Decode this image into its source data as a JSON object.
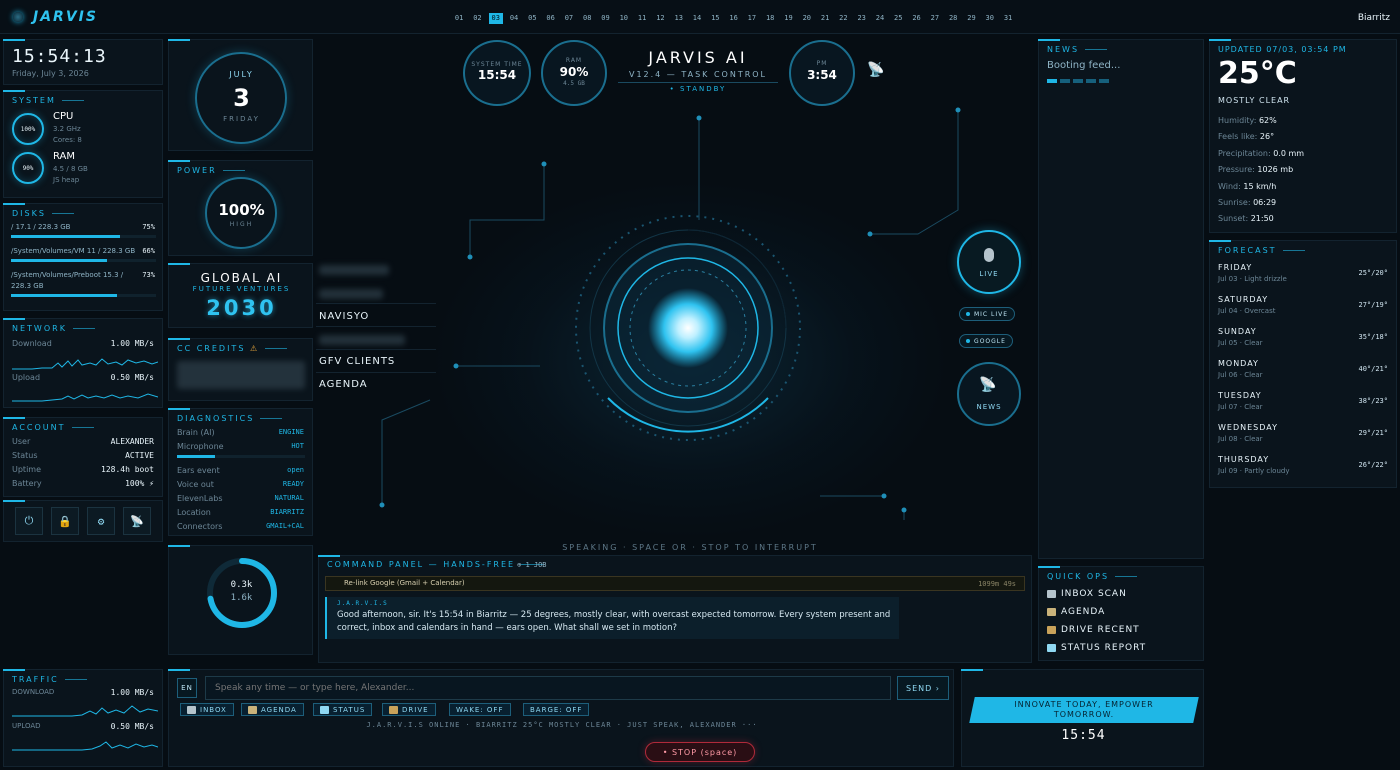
{
  "header": {
    "logo": "JARVIS",
    "days": [
      "01",
      "02",
      "03",
      "04",
      "05",
      "06",
      "07",
      "08",
      "09",
      "10",
      "11",
      "12",
      "13",
      "14",
      "15",
      "16",
      "17",
      "18",
      "19",
      "20",
      "21",
      "22",
      "23",
      "24",
      "25",
      "26",
      "27",
      "28",
      "29",
      "30",
      "31"
    ],
    "active_day": "03",
    "city": "Biarritz"
  },
  "clock": {
    "time": "15:54:13",
    "date": "Friday, July 3, 2026"
  },
  "system": {
    "title": "SYSTEM",
    "cpu": {
      "label": "CPU",
      "pct": "100%",
      "ghz": "3.2 GHz",
      "cores": "Cores: 8"
    },
    "ram": {
      "label": "RAM",
      "pct": "90%",
      "mem": "4.5 / 8 GB",
      "note": "JS heap"
    }
  },
  "disks": {
    "title": "DISKS",
    "items": [
      {
        "name": "/ 17.1 / 228.3 GB",
        "extra": "",
        "pct": "75%",
        "value": 75
      },
      {
        "name": "/System/Volumes/VM 11 / 228.3 GB",
        "extra": "",
        "pct": "66%",
        "value": 66
      },
      {
        "name": "/System/Volumes/Preboot 15.3 /",
        "extra": "228.3 GB",
        "pct": "73%",
        "value": 73
      }
    ]
  },
  "network": {
    "title": "NETWORK",
    "download_label": "Download",
    "download_value": "1.00 MB/s",
    "upload_label": "Upload",
    "upload_value": "0.50 MB/s"
  },
  "account": {
    "title": "ACCOUNT",
    "rows": [
      {
        "k": "User",
        "v": "ALEXANDER"
      },
      {
        "k": "Status",
        "v": "ACTIVE"
      },
      {
        "k": "Uptime",
        "v": "128.4h boot"
      },
      {
        "k": "Battery",
        "v": "100% ⚡"
      }
    ]
  },
  "traffic": {
    "title": "TRAFFIC",
    "download_label": "DOWNLOAD",
    "download_value": "1.00 MB/s",
    "upload_label": "UPLOAD",
    "upload_value": "0.50 MB/s"
  },
  "calendar": {
    "month": "JULY",
    "day": "3",
    "weekday": "FRIDAY"
  },
  "power": {
    "title": "POWER",
    "value": "100%",
    "level": "HIGH"
  },
  "brand": {
    "title": "GLOBAL AI",
    "subtitle": "FUTURE VENTURES",
    "year": "2030"
  },
  "cc_credits": {
    "title": "CC CREDITS",
    "warning": "⚠"
  },
  "diagnostics": {
    "title": "DIAGNOSTICS",
    "rows": [
      {
        "k": "Brain (AI)",
        "v": "ENGINE"
      },
      {
        "k": "Microphone",
        "v": "HOT"
      },
      {
        "k": "Ears event",
        "v": "open"
      },
      {
        "k": "Voice out",
        "v": "READY"
      },
      {
        "k": "ElevenLabs",
        "v": "NATURAL"
      },
      {
        "k": "Location",
        "v": "BIARRITZ"
      },
      {
        "k": "Connectors",
        "v": "GMAIL+CAL"
      }
    ]
  },
  "gauge": {
    "top": "0.3k",
    "bottom": "1.6k",
    "fraction": 0.72
  },
  "menu": {
    "items": [
      "NAVISYO",
      "GFV CLIENTS",
      "AGENDA"
    ]
  },
  "center": {
    "sys_time_label": "SYSTEM TIME",
    "sys_time": "15:54",
    "ram_label": "RAM",
    "ram_pct": "90%",
    "ram_gb": "4.5 GB",
    "title": "JARVIS AI",
    "version": "V12.4 — TASK CONTROL",
    "status": "STANDBY",
    "pm_label": "PM",
    "pm_time": "3:54",
    "live_label": "LIVE",
    "mic_live": "MIC LIVE",
    "google": "GOOGLE",
    "news_label": "NEWS",
    "speaking": "SPEAKING · SPACE OR · STOP TO INTERRUPT"
  },
  "command": {
    "title": "COMMAND PANEL — HANDS-FREE",
    "job": "1 JOB",
    "task": "Re-link Google (Gmail + Calendar)",
    "task_time": "1099m 49s",
    "speaker": "J.A.R.V.I.S",
    "message": "Good afternoon, sir. It's 15:54 in Biarritz — 25 degrees, mostly clear, with overcast expected tomorrow. Every system present and correct, inbox and calendars in hand — ears open. What shall we set in motion?"
  },
  "input": {
    "lang": "EN",
    "placeholder": "Speak any time — or type here, Alexander...",
    "send": "SEND ›",
    "quick": [
      "INBOX",
      "AGENDA",
      "STATUS",
      "DRIVE",
      "WAKE: OFF",
      "BARGE: OFF"
    ],
    "ticker": "J.A.R.V.I.S ONLINE · BIARRITZ 25°C MOSTLY CLEAR · JUST SPEAK, ALEXANDER ···",
    "stop": "• STOP (space)"
  },
  "news": {
    "title": "NEWS",
    "status": "Booting feed..."
  },
  "quick_ops": {
    "title": "QUICK OPS",
    "items": [
      "INBOX SCAN",
      "AGENDA",
      "DRIVE RECENT",
      "STATUS REPORT"
    ]
  },
  "slogan": {
    "text": "INNOVATE TODAY, EMPOWER TOMORROW.",
    "time": "15:54"
  },
  "weather": {
    "updated_label": "UPDATED",
    "updated": "07/03, 03:54 PM",
    "temp": "25°C",
    "cond": "MOSTLY CLEAR",
    "rows": [
      {
        "k": "Humidity:",
        "v": "62%"
      },
      {
        "k": "Feels like:",
        "v": "26°"
      },
      {
        "k": "Precipitation:",
        "v": "0.0 mm"
      },
      {
        "k": "Pressure:",
        "v": "1026 mb"
      },
      {
        "k": "Wind:",
        "v": "15 km/h"
      },
      {
        "k": "Sunrise:",
        "v": "06:29"
      },
      {
        "k": "Sunset:",
        "v": "21:50"
      }
    ]
  },
  "forecast": {
    "title": "FORECAST",
    "days": [
      {
        "day": "FRIDAY",
        "sub": "Jul 03 · Light drizzle",
        "temp": "25°/20°"
      },
      {
        "day": "SATURDAY",
        "sub": "Jul 04 · Overcast",
        "temp": "27°/19°"
      },
      {
        "day": "SUNDAY",
        "sub": "Jul 05 · Clear",
        "temp": "35°/18°"
      },
      {
        "day": "MONDAY",
        "sub": "Jul 06 · Clear",
        "temp": "40°/21°"
      },
      {
        "day": "TUESDAY",
        "sub": "Jul 07 · Clear",
        "temp": "38°/23°"
      },
      {
        "day": "WEDNESDAY",
        "sub": "Jul 08 · Clear",
        "temp": "29°/21°"
      },
      {
        "day": "THURSDAY",
        "sub": "Jul 09 · Partly cloudy",
        "temp": "26°/22°"
      }
    ]
  }
}
